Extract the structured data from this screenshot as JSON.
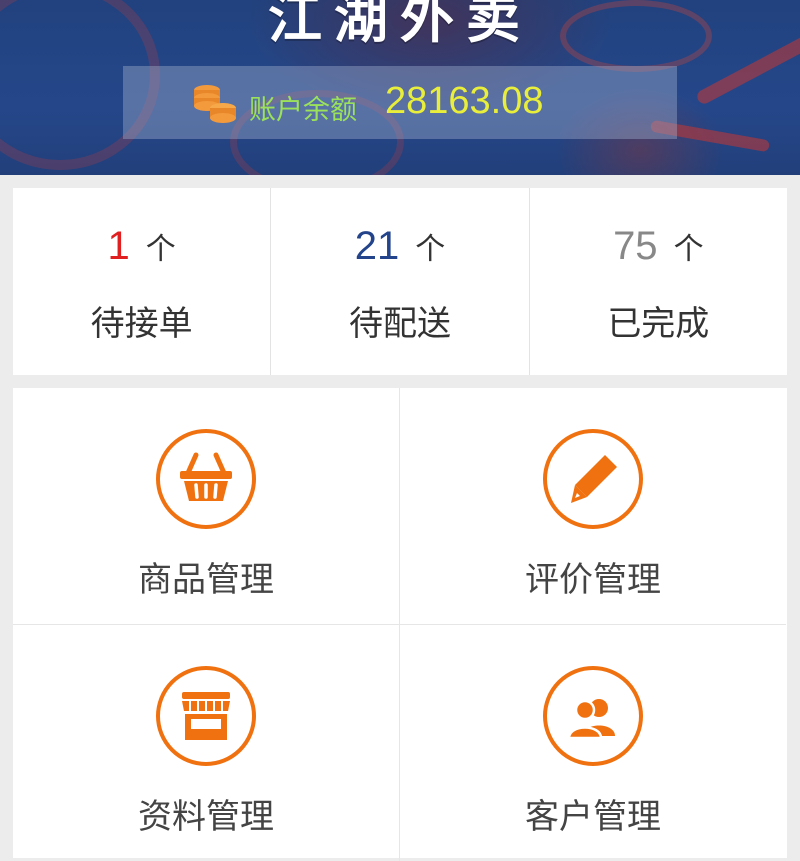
{
  "header": {
    "title": "江湖外卖",
    "balance_label": "账户余额",
    "balance_value": "28163.08",
    "colors": {
      "background": "#23448a",
      "label": "#9be25a",
      "value": "#e9ee3a"
    }
  },
  "stats": [
    {
      "count": "1",
      "unit": "个",
      "label": "待接单",
      "color": "#e02020"
    },
    {
      "count": "21",
      "unit": "个",
      "label": "待配送",
      "color": "#23448a"
    },
    {
      "count": "75",
      "unit": "个",
      "label": "已完成",
      "color": "#888888"
    }
  ],
  "menu": [
    {
      "label": "商品管理",
      "icon": "basket-icon"
    },
    {
      "label": "评价管理",
      "icon": "pencil-icon"
    },
    {
      "label": "资料管理",
      "icon": "storefront-icon"
    },
    {
      "label": "客户管理",
      "icon": "users-icon"
    }
  ],
  "accent_color": "#f0710f"
}
